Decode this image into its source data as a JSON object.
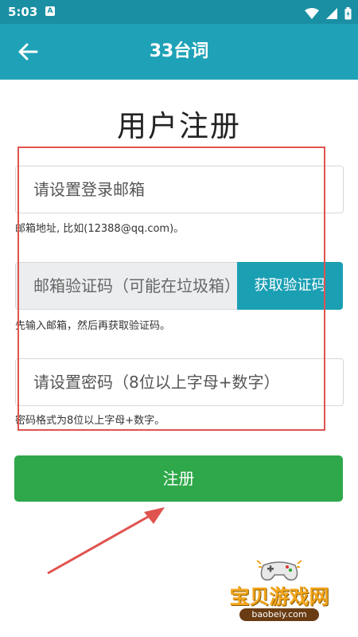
{
  "status_bar": {
    "time": "5:03",
    "notification_letter": "A"
  },
  "app_bar": {
    "title": "33台词"
  },
  "page_title": "用户注册",
  "form": {
    "email_placeholder": "请设置登录邮箱",
    "email_hint": "邮箱地址, 比如(12388@qq.com)。",
    "code_placeholder": "邮箱验证码（可能在垃圾箱）",
    "code_button": "获取验证码",
    "code_hint": "先输入邮箱，然后再获取验证码。",
    "password_placeholder": "请设置密码（8位以上字母+数字）",
    "password_hint": "密码格式为8位以上字母+数字。",
    "register_button": "注册"
  },
  "watermark": {
    "text": "宝贝游戏网",
    "url": "baobeiy.com"
  },
  "colors": {
    "status_bar": "#1a8fa3",
    "app_bar": "#1fa2b7",
    "code_button": "#1a9fb3",
    "register_button": "#2ea84a",
    "annotation_red": "#e0534f"
  },
  "icons": [
    "back-arrow-icon",
    "wifi-icon",
    "signal-icon",
    "battery-icon"
  ]
}
